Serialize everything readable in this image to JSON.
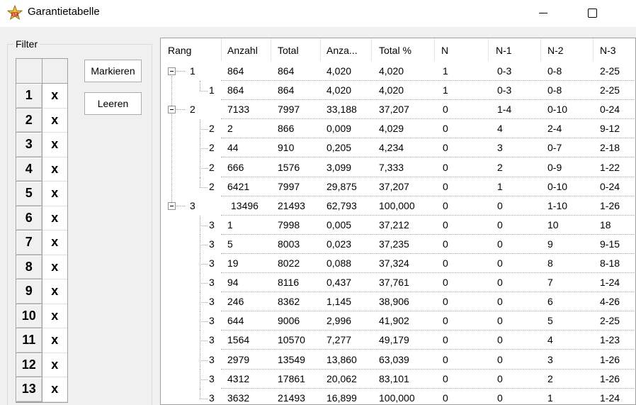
{
  "window": {
    "title": "Garantietabelle",
    "minimize_icon": "minimize-icon",
    "maximize_icon": "maximize-icon"
  },
  "filter": {
    "label": "Filter",
    "rows": [
      {
        "num": "1",
        "mark": "x"
      },
      {
        "num": "2",
        "mark": "x"
      },
      {
        "num": "3",
        "mark": "x"
      },
      {
        "num": "4",
        "mark": "x"
      },
      {
        "num": "5",
        "mark": "x"
      },
      {
        "num": "6",
        "mark": "x"
      },
      {
        "num": "7",
        "mark": "x"
      },
      {
        "num": "8",
        "mark": "x"
      },
      {
        "num": "9",
        "mark": "x"
      },
      {
        "num": "10",
        "mark": "x"
      },
      {
        "num": "11",
        "mark": "x"
      },
      {
        "num": "12",
        "mark": "x"
      },
      {
        "num": "13",
        "mark": "x"
      }
    ],
    "mark_button": "Markieren",
    "clear_button": "Leeren"
  },
  "table": {
    "columns": [
      "Rang",
      "Anzahl",
      "Total",
      "Anza...",
      "Total %",
      "N",
      "N-1",
      "N-2",
      "N-3"
    ],
    "rows": [
      {
        "level": 0,
        "expanded": true,
        "rang": "1",
        "cells": [
          "864",
          "864",
          "4,020",
          "4,020",
          "1",
          "0-3",
          "0-8",
          "2-25"
        ]
      },
      {
        "level": 1,
        "last": true,
        "rang": "1",
        "cells": [
          "864",
          "864",
          "4,020",
          "4,020",
          "1",
          "0-3",
          "0-8",
          "2-25"
        ]
      },
      {
        "level": 0,
        "expanded": true,
        "rang": "2",
        "cells": [
          "7133",
          "7997",
          "33,188",
          "37,207",
          "0",
          "1-4",
          "0-10",
          "0-24"
        ]
      },
      {
        "level": 1,
        "rang": "2",
        "cells": [
          "2",
          "866",
          "0,009",
          "4,029",
          "0",
          "4",
          "2-4",
          "9-12"
        ]
      },
      {
        "level": 1,
        "rang": "2",
        "cells": [
          "44",
          "910",
          "0,205",
          "4,234",
          "0",
          "3",
          "0-7",
          "2-18"
        ]
      },
      {
        "level": 1,
        "rang": "2",
        "cells": [
          "666",
          "1576",
          "3,099",
          "7,333",
          "0",
          "2",
          "0-9",
          "1-22"
        ]
      },
      {
        "level": 1,
        "last": true,
        "rang": "2",
        "cells": [
          "6421",
          "7997",
          "29,875",
          "37,207",
          "0",
          "1",
          "0-10",
          "0-24"
        ]
      },
      {
        "level": 0,
        "expanded": true,
        "rang": "3",
        "cells": [
          "13496",
          "21493",
          "62,793",
          "100,000",
          "0",
          "0",
          "1-10",
          "1-26"
        ]
      },
      {
        "level": 1,
        "rang": "3",
        "cells": [
          "1",
          "7998",
          "0,005",
          "37,212",
          "0",
          "0",
          "10",
          "18"
        ]
      },
      {
        "level": 1,
        "rang": "3",
        "cells": [
          "5",
          "8003",
          "0,023",
          "37,235",
          "0",
          "0",
          "9",
          "9-15"
        ]
      },
      {
        "level": 1,
        "rang": "3",
        "cells": [
          "19",
          "8022",
          "0,088",
          "37,324",
          "0",
          "0",
          "8",
          "8-18"
        ]
      },
      {
        "level": 1,
        "rang": "3",
        "cells": [
          "94",
          "8116",
          "0,437",
          "37,761",
          "0",
          "0",
          "7",
          "1-24"
        ]
      },
      {
        "level": 1,
        "rang": "3",
        "cells": [
          "246",
          "8362",
          "1,145",
          "38,906",
          "0",
          "0",
          "6",
          "4-26"
        ]
      },
      {
        "level": 1,
        "rang": "3",
        "cells": [
          "644",
          "9006",
          "2,996",
          "41,902",
          "0",
          "0",
          "5",
          "2-25"
        ]
      },
      {
        "level": 1,
        "rang": "3",
        "cells": [
          "1564",
          "10570",
          "7,277",
          "49,179",
          "0",
          "0",
          "4",
          "1-23"
        ]
      },
      {
        "level": 1,
        "rang": "3",
        "cells": [
          "2979",
          "13549",
          "13,860",
          "63,039",
          "0",
          "0",
          "3",
          "1-26"
        ]
      },
      {
        "level": 1,
        "rang": "3",
        "cells": [
          "4312",
          "17861",
          "20,062",
          "83,101",
          "0",
          "0",
          "2",
          "1-26"
        ]
      },
      {
        "level": 1,
        "last": true,
        "rang": "3",
        "cells": [
          "3632",
          "21493",
          "16,899",
          "100,000",
          "0",
          "0",
          "1",
          "1-24"
        ]
      }
    ]
  }
}
